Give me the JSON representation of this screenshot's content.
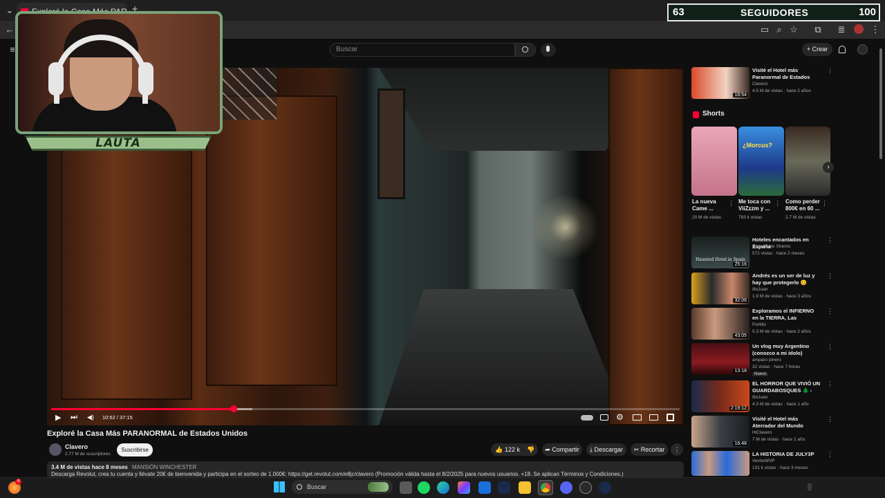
{
  "browser": {
    "tab_title": "Exploré la Casa Más PARANORMAL",
    "new_tab": "+",
    "collapse": "⌄",
    "back": "←"
  },
  "youtube": {
    "search_placeholder": "Buscar",
    "create_label": "Crear",
    "create_plus": "+"
  },
  "overlay": {
    "followers_current": "63",
    "followers_label": "SEGUIDORES",
    "followers_goal": "100",
    "streamer_name": "LAUTA"
  },
  "player": {
    "time": "10:52 / 37:15",
    "progress_fraction": 0.29,
    "buffered_fraction": 0.32
  },
  "video": {
    "title": "Exploré la Casa Más PARANORMAL de Estados Unidos",
    "channel": "Clavero",
    "subscribers": "2.77 M de suscriptores",
    "subscribe_label": "Suscribirse",
    "likes": "122 k",
    "share_label": "Compartir",
    "download_label": "Descargar",
    "clip_label": "Recortar",
    "views_date": "3.4 M de vistas  hace 8 meses",
    "tag": "MANSIÓN WINCHESTER",
    "desc_line": "Descarga Revolut, crea tu cuenta y llévate 20€ de bienvenida y participa en el sorteo de 1.000€: https://get.revolut.com/e8jc/clavero (Promoción válida hasta el 8/2/2025 para nuevos usuarios. +18. Se aplican Términos y Condiciones.)"
  },
  "sidebar": {
    "top_rec": {
      "title": "Visité el Hotel más Paranormal de Estados Unidos | Clown ...",
      "channel": "Clavero",
      "meta": "4.5 M de vistas · hace 2 años",
      "duration": "18:54"
    },
    "shorts_heading": "Shorts",
    "shorts": [
      {
        "title": "La nueva Came ...",
        "views": "20 M de vistas",
        "overlay": ""
      },
      {
        "title": "Me toca con ViiZzzm y ...",
        "views": "783 k vistas",
        "overlay": "¿Morcus?"
      },
      {
        "title": "Como perder 800€ en 60 ...",
        "views": "2.7 M de vistas",
        "overlay": ""
      }
    ],
    "recs": [
      {
        "title": "Hoteles encantados en España",
        "channel": "Expediente Xtremo",
        "meta": "571 vistas · hace 2 meses",
        "duration": "25:16",
        "badge": "",
        "thumb_text": "Haunted Hotel in Spain"
      },
      {
        "title": "Andrés es un ser de luz y hay que protegerlo 😊",
        "channel": "IlloJuan",
        "meta": "1.9 M de vistas · hace 3 años",
        "duration": "32:06",
        "badge": "",
        "thumb_text": ""
      },
      {
        "title": "Exploramos el INFIERNO en la TIERRA, Las Catacumbas de ...",
        "channel": "Portillo",
        "meta": "5.3 M de vistas · hace 2 años",
        "duration": "43:05",
        "badge": "",
        "thumb_text": ""
      },
      {
        "title": "Un vlog muy Argentino (conozco a mi ídolo)",
        "channel": "amparo pinero",
        "meta": "32 vistas · hace 7 horas",
        "duration": "13:18",
        "badge": "Nuevo",
        "thumb_text": ""
      },
      {
        "title": "EL HORROR QUE VIVIÓ UN GUARDABOSQUES 🌲 - Fears ...",
        "channel": "IlloJuan",
        "meta": "4.3 M de vistas · hace 1 año",
        "duration": "2:19:12",
        "badge": "",
        "thumb_text": ""
      },
      {
        "title": "Visité el Hotel más Aterrador del Mundo",
        "channel": "HiClavero",
        "meta": "7 M de vistas · hace 1 año",
        "duration": "16:48",
        "badge": "",
        "thumb_text": ""
      },
      {
        "title": "LA HISTORIA DE JULY3P",
        "channel": "VectorMVP",
        "meta": "131 k vistas · hace 3 meses",
        "duration": "",
        "badge": "",
        "thumb_text": ""
      }
    ]
  },
  "taskbar": {
    "search_label": "Buscar",
    "firefox_badge": "4"
  },
  "icons": {
    "play": "▶",
    "next": "⏭",
    "volume": "🔊",
    "kebab": "⋮",
    "like": "👍",
    "dislike": "👎",
    "search": "🔍",
    "mic": "🎙",
    "bell": "🔔",
    "menu": "≡",
    "chevron": "›",
    "windows": "⊞"
  },
  "colors": {
    "accent_red": "#ff0033",
    "overlay_green": "#9bbf8a"
  }
}
